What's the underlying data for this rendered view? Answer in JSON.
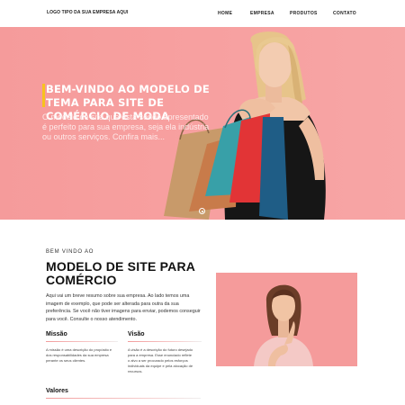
{
  "header": {
    "logo": "LOGO TIPO DA SUA EMPRESA AQUI",
    "nav": [
      "HOME",
      "EMPRESA",
      "PRODUTOS",
      "CONTATO"
    ]
  },
  "hero": {
    "title": "BEM-VINDO AO MODELO DE TEMA PARA SITE DE COMÉRCIO DE MODA",
    "text": "O modelo de site que está sendo apresentado é perfeito para sua empresa, seja ela indústria ou outros serviços. Confira mais...",
    "accent": "#f7c31e",
    "background": "#f7a0a0"
  },
  "intro": {
    "kicker": "BEM VINDO AO",
    "title": "MODELO DE SITE PARA COMÉRCIO",
    "text": "Aqui vai um breve resumo sobre sua empresa. Ao lado temos uma imagem de exemplo, que pode ser alterada para outra da sua preferência. Se você não tiver imagens para enviar, podemos conseguir para você. Consulte o nosso atendimento."
  },
  "columns": [
    {
      "title": "Missão",
      "text": "A missão é uma descrição do propósito e dos responsabilidades da sua empresa perante os seus clientes."
    },
    {
      "title": "Visão",
      "text": "A visão é a descrição do futuro desejado para a empresa. Esse enunciado reflete o alvo a ser procurado pelos esforços individuais da equipe e pela alocação de recursos."
    }
  ],
  "values": {
    "title": "Valores"
  }
}
